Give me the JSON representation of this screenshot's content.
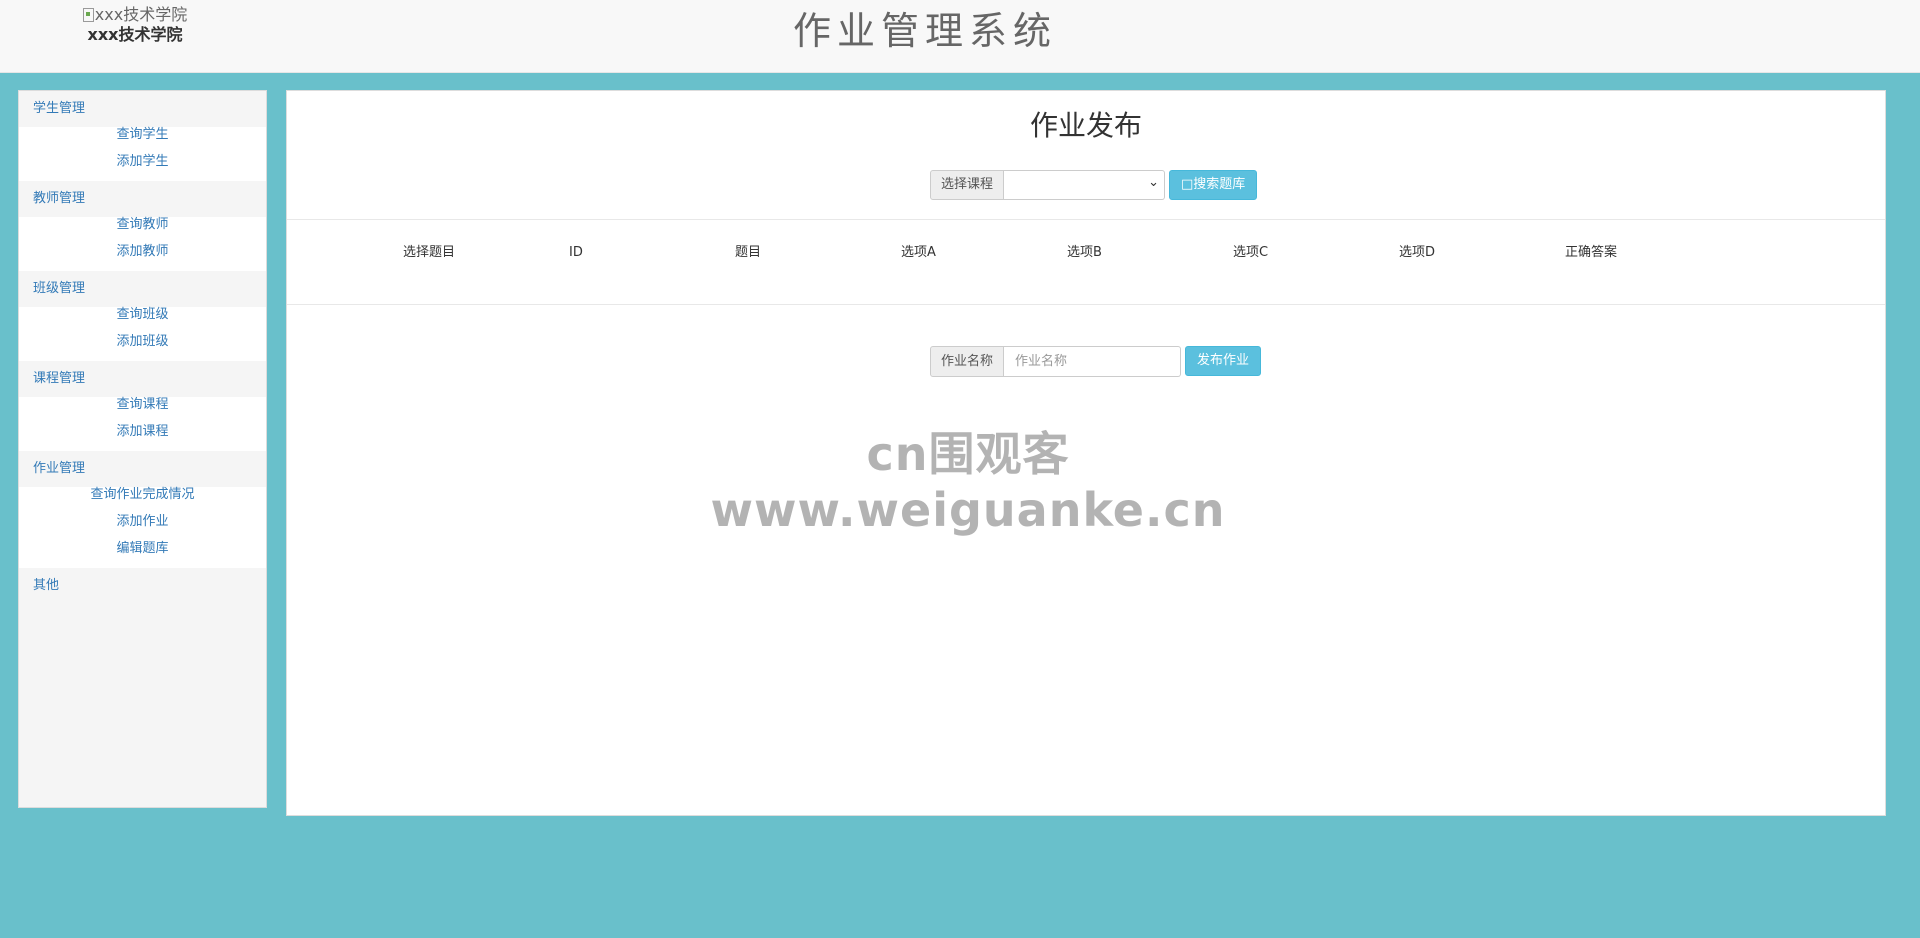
{
  "header": {
    "logo_alt": "xxx技术学院",
    "school_name": "xxx技术学院",
    "system_title": "作业管理系统"
  },
  "sidebar": {
    "groups": [
      {
        "title": "学生管理",
        "items": [
          "查询学生",
          "添加学生"
        ]
      },
      {
        "title": "教师管理",
        "items": [
          "查询教师",
          "添加教师"
        ]
      },
      {
        "title": "班级管理",
        "items": [
          "查询班级",
          "添加班级"
        ]
      },
      {
        "title": "课程管理",
        "items": [
          "查询课程",
          "添加课程"
        ]
      },
      {
        "title": "作业管理",
        "items": [
          "查询作业完成情况",
          "添加作业",
          "编辑题库"
        ]
      },
      {
        "title": "其他",
        "items": []
      }
    ]
  },
  "main": {
    "title": "作业发布",
    "course_label": "选择课程",
    "course_selected": "",
    "search_button": "□搜索题库",
    "table_headers": [
      "选择题目",
      "ID",
      "题目",
      "选项A",
      "选项B",
      "选项C",
      "选项D",
      "正确答案"
    ],
    "homework_label": "作业名称",
    "homework_placeholder": "作业名称",
    "publish_button": "发布作业"
  },
  "watermark": "cn围观客www.weiguanke.cn"
}
